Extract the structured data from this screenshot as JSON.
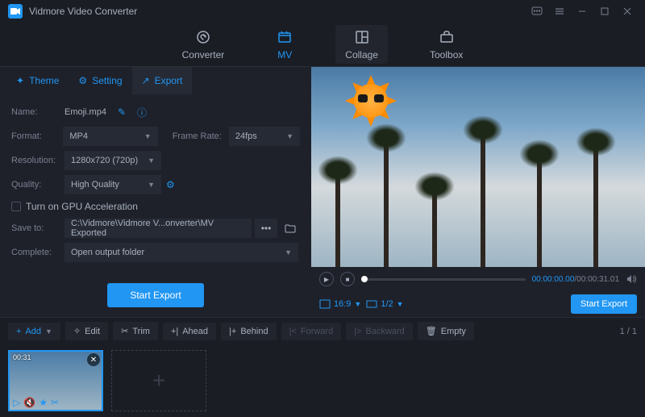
{
  "app": {
    "title": "Vidmore Video Converter"
  },
  "mainTabs": {
    "converter": "Converter",
    "mv": "MV",
    "collage": "Collage",
    "toolbox": "Toolbox"
  },
  "subTabs": {
    "theme": "Theme",
    "setting": "Setting",
    "export": "Export"
  },
  "export": {
    "nameLabel": "Name:",
    "nameValue": "Emoji.mp4",
    "formatLabel": "Format:",
    "formatValue": "MP4",
    "frameRateLabel": "Frame Rate:",
    "frameRateValue": "24fps",
    "resolutionLabel": "Resolution:",
    "resolutionValue": "1280x720 (720p)",
    "qualityLabel": "Quality:",
    "qualityValue": "High Quality",
    "gpuLabel": "Turn on GPU Acceleration",
    "saveToLabel": "Save to:",
    "saveToPath": "C:\\Vidmore\\Vidmore V...onverter\\MV Exported",
    "completeLabel": "Complete:",
    "completeValue": "Open output folder",
    "startButton": "Start Export"
  },
  "player": {
    "current": "00:00:00.00",
    "duration": "00:00:31.01",
    "aspect": "16:9",
    "scale": "1/2",
    "startButton": "Start Export"
  },
  "toolbar": {
    "add": "Add",
    "edit": "Edit",
    "trim": "Trim",
    "ahead": "Ahead",
    "behind": "Behind",
    "forward": "Forward",
    "backward": "Backward",
    "empty": "Empty",
    "page": "1 / 1"
  },
  "thumb": {
    "duration": "00:31"
  }
}
